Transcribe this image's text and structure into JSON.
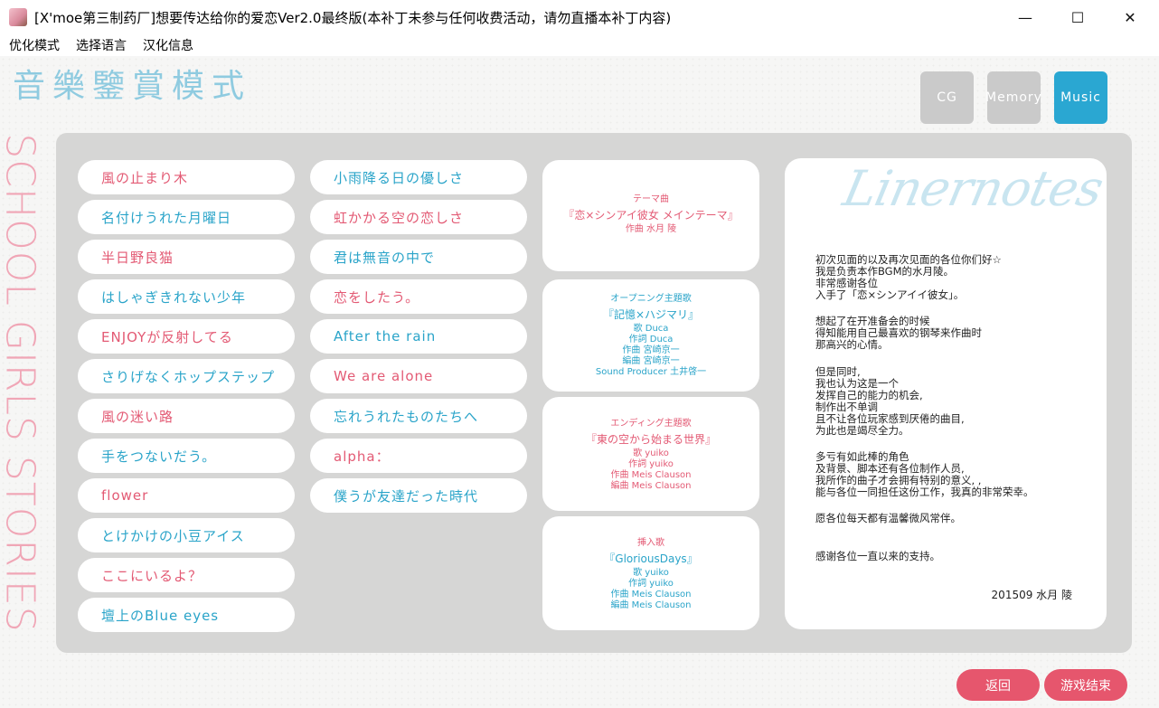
{
  "window": {
    "title": "[X'moe第三制药厂]想要传达给你的爱恋Ver2.0最终版(本补丁未参与任何收费活动，请勿直播本补丁内容)",
    "minimize": "—",
    "maximize": "☐",
    "close": "✕"
  },
  "menu": [
    "优化模式",
    "选择语言",
    "汉化信息"
  ],
  "mode_title": "音樂鑒賞模式",
  "side_text": "SCHOOL GIRLS STORIES",
  "tabs": [
    "CG",
    "Memory",
    "Music"
  ],
  "songs_col1": [
    "風の止まり木",
    "名付けうれた月曜日",
    "半日野良猫",
    "はしゃぎきれない少年",
    "ENJOYが反射してる",
    "さりげなくホップステップ",
    "風の迷い路",
    "手をつないだう。",
    "flower",
    "とけかけの小豆アイス",
    "ここにいるよ？",
    "壇上のBlue eyes"
  ],
  "songs_col2": [
    "小雨降る日の優しさ",
    "虹かかる空の恋しさ",
    "君は無音の中で",
    "恋をしたう。",
    "After the rain",
    "We are alone",
    "忘れうれたものたちへ",
    "alpha：",
    "僕うが友達だった時代"
  ],
  "cards": [
    {
      "type": "テーマ曲",
      "title": "『恋×シンアイ彼女 メインテーマ』",
      "lines": [
        "作曲 水月 陵"
      ]
    },
    {
      "type": "オープニング主題歌",
      "title": "『記憶×ハジマリ』",
      "lines": [
        "歌 Duca",
        "作詞 Duca",
        "作曲 宮崎京一",
        "編曲 宮崎京一",
        "Sound Producer 土井啓一"
      ]
    },
    {
      "type": "エンディング主題歌",
      "title": "『東の空から始まる世界』",
      "lines": [
        "歌 yuiko",
        "作詞 yuiko",
        "作曲 Meis Clauson",
        "編曲 Meis Clauson"
      ]
    },
    {
      "type": "挿入歌",
      "title": "『GloriousDays』",
      "lines": [
        "歌 yuiko",
        "作詞 yuiko",
        "作曲 Meis Clauson",
        "編曲 Meis Clauson"
      ]
    }
  ],
  "liner": {
    "logo": "Linernotes",
    "paragraphs": [
      [
        "初次见面的以及再次见面的各位你们好☆",
        "我是负责本作BGM的水月陵。",
        "非常感谢各位",
        "入手了「恋×シンアイイ彼女」。"
      ],
      [
        "想起了在开准备会的时候",
        "得知能用自己最喜欢的钢琴来作曲时",
        "那高兴的心情。"
      ],
      [
        "但是同时,",
        "我也认为这是一个",
        "发挥自己的能力的机会,",
        "制作出不单调",
        "且不让各位玩家感到厌倦的曲目,",
        "为此也是竭尽全力。"
      ],
      [
        "多亏有如此棒的角色",
        "及背景、脚本还有各位制作人员,",
        "我所作的曲子才会拥有特别的意义, ,",
        "能与各位一同担任这份工作，我真的非常荣幸。"
      ],
      [
        "愿各位每天都有温馨微风常伴。"
      ],
      [
        "感谢各位一直以来的支持。"
      ]
    ],
    "signature": "201509 水月 陵"
  },
  "buttons": {
    "back": "返回",
    "quit": "游戏结束"
  },
  "colors": {
    "accent_blue": "#2aa7d2",
    "accent_pink": "#e6566d",
    "tab_inactive": "#cacaca"
  }
}
